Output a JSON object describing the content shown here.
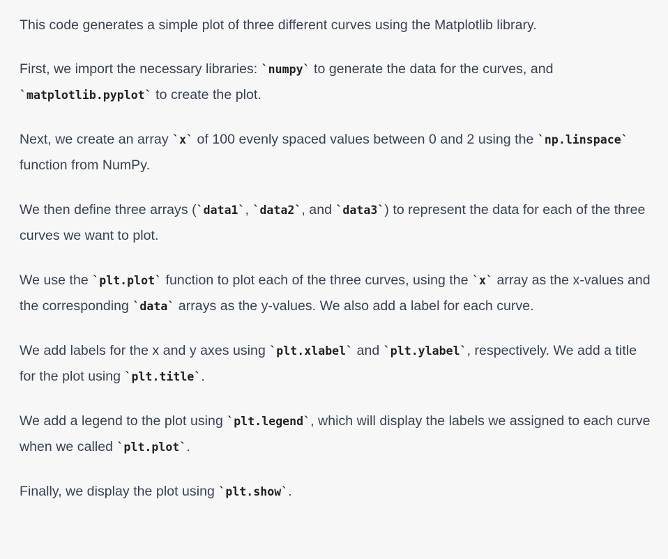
{
  "paragraphs": [
    [
      {
        "t": "This code generates a simple plot of three different curves using the Matplotlib library.",
        "c": false
      }
    ],
    [
      {
        "t": "First, we import the necessary libraries: ",
        "c": false
      },
      {
        "t": "`numpy`",
        "c": true
      },
      {
        "t": " to generate the data for the curves, and ",
        "c": false
      },
      {
        "t": "`matplotlib.pyplot`",
        "c": true
      },
      {
        "t": " to create the plot.",
        "c": false
      }
    ],
    [
      {
        "t": "Next, we create an array ",
        "c": false
      },
      {
        "t": "`x`",
        "c": true
      },
      {
        "t": " of 100 evenly spaced values between 0 and 2 using the ",
        "c": false
      },
      {
        "t": "`np.linspace`",
        "c": true
      },
      {
        "t": " function from NumPy.",
        "c": false
      }
    ],
    [
      {
        "t": "We then define three arrays (",
        "c": false
      },
      {
        "t": "`data1`",
        "c": true
      },
      {
        "t": ", ",
        "c": false
      },
      {
        "t": "`data2`",
        "c": true
      },
      {
        "t": ", and ",
        "c": false
      },
      {
        "t": "`data3`",
        "c": true
      },
      {
        "t": ") to represent the data for each of the three curves we want to plot.",
        "c": false
      }
    ],
    [
      {
        "t": "We use the ",
        "c": false
      },
      {
        "t": "`plt.plot`",
        "c": true
      },
      {
        "t": " function to plot each of the three curves, using the ",
        "c": false
      },
      {
        "t": "`x`",
        "c": true
      },
      {
        "t": " array as the x-values and the corresponding ",
        "c": false
      },
      {
        "t": "`data`",
        "c": true
      },
      {
        "t": " arrays as the y-values. We also add a label for each curve.",
        "c": false
      }
    ],
    [
      {
        "t": "We add labels for the x and y axes using ",
        "c": false
      },
      {
        "t": "`plt.xlabel`",
        "c": true
      },
      {
        "t": " and ",
        "c": false
      },
      {
        "t": "`plt.ylabel`",
        "c": true
      },
      {
        "t": ", respectively. We add a title for the plot using ",
        "c": false
      },
      {
        "t": "`plt.title`",
        "c": true
      },
      {
        "t": ".",
        "c": false
      }
    ],
    [
      {
        "t": "We add a legend to the plot using ",
        "c": false
      },
      {
        "t": "`plt.legend`",
        "c": true
      },
      {
        "t": ", which will display the labels we assigned to each curve when we called ",
        "c": false
      },
      {
        "t": "`plt.plot`",
        "c": true
      },
      {
        "t": ".",
        "c": false
      }
    ],
    [
      {
        "t": "Finally, we display the plot using ",
        "c": false
      },
      {
        "t": "`plt.show`",
        "c": true
      },
      {
        "t": ".",
        "c": false
      }
    ]
  ]
}
